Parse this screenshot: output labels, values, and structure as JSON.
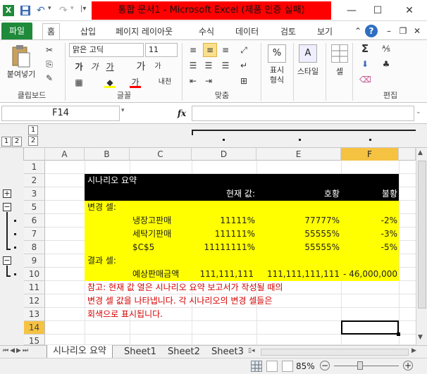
{
  "window": {
    "title": "통합 문서1  -  Microsoft Excel (제품 인증 실패)",
    "minimize": "—",
    "maximize": "☐",
    "close": "✕"
  },
  "tabs": {
    "file": "파일",
    "items": [
      "홈",
      "삽입",
      "페이지 레이아웃",
      "수식",
      "데이터",
      "검토",
      "보기"
    ]
  },
  "ribbon": {
    "paste": "붙여넣기",
    "clipboard": "클립보드",
    "font_name": "맑은 고딕",
    "font_size": "11",
    "font_group": "글꼴",
    "bold": "가",
    "italic": "가",
    "underline": "가",
    "grow": "가",
    "shrink": "가",
    "font_color": "가",
    "phonetic": "내천",
    "align_group": "맞춤",
    "number_format": "%",
    "number_label": "표시\n형식",
    "style_label": "스타일",
    "cell_label": "셀",
    "edit_group": "편집",
    "sum_icon": "Σ",
    "sort_icon": "⅍",
    "find_icon": "♣"
  },
  "formula_bar": {
    "name_box": "F14",
    "fx": "fx",
    "formula": ""
  },
  "outline": {
    "row_levels": [
      "1",
      "2"
    ],
    "col_levels": [
      "1",
      "2"
    ],
    "expand": "+",
    "collapse": "−"
  },
  "columns": [
    "A",
    "B",
    "C",
    "D",
    "E",
    "F"
  ],
  "rows": [
    "1",
    "2",
    "3",
    "5",
    "6",
    "7",
    "8",
    "9",
    "10",
    "11",
    "12",
    "13",
    "14",
    "15"
  ],
  "summary": {
    "title": "시나리오 요약",
    "header_current": "현재 값:",
    "header_s1": "호황",
    "header_s2": "불황",
    "changing_label": "변경 셀:",
    "result_label": "결과 셀:",
    "changing": [
      {
        "name": "냉장고판매",
        "current": "11111%",
        "s1": "77777%",
        "s2": "-2%"
      },
      {
        "name": "세탁기판매",
        "current": "111111%",
        "s1": "55555%",
        "s2": "-3%"
      },
      {
        "name": "$C$5",
        "current": "11111111%",
        "s1": "55555%",
        "s2": "-5%"
      }
    ],
    "result": {
      "name": "예상판매금액",
      "current": "111,111,111",
      "s1": "111,111,111,111",
      "s2": "- 46,000,000"
    },
    "note_lines": [
      "참고: 현재 값 열은 시나리오 요약 보고서가 작성될 때의",
      "변경 셀 값을 나타냅니다. 각 시나리오의 변경 셀들은",
      "회색으로 표시됩니다."
    ]
  },
  "sheet_tabs": [
    "시나리오 요약",
    "Sheet1",
    "Sheet2",
    "Sheet3"
  ],
  "status": {
    "zoom": "85%"
  },
  "colors": {
    "title_red": "#ff0000",
    "file_green": "#1f8a3a",
    "yellow": "#ffff00",
    "black": "#000000",
    "note_red": "#d40000",
    "selected_row": "#f5c242"
  }
}
